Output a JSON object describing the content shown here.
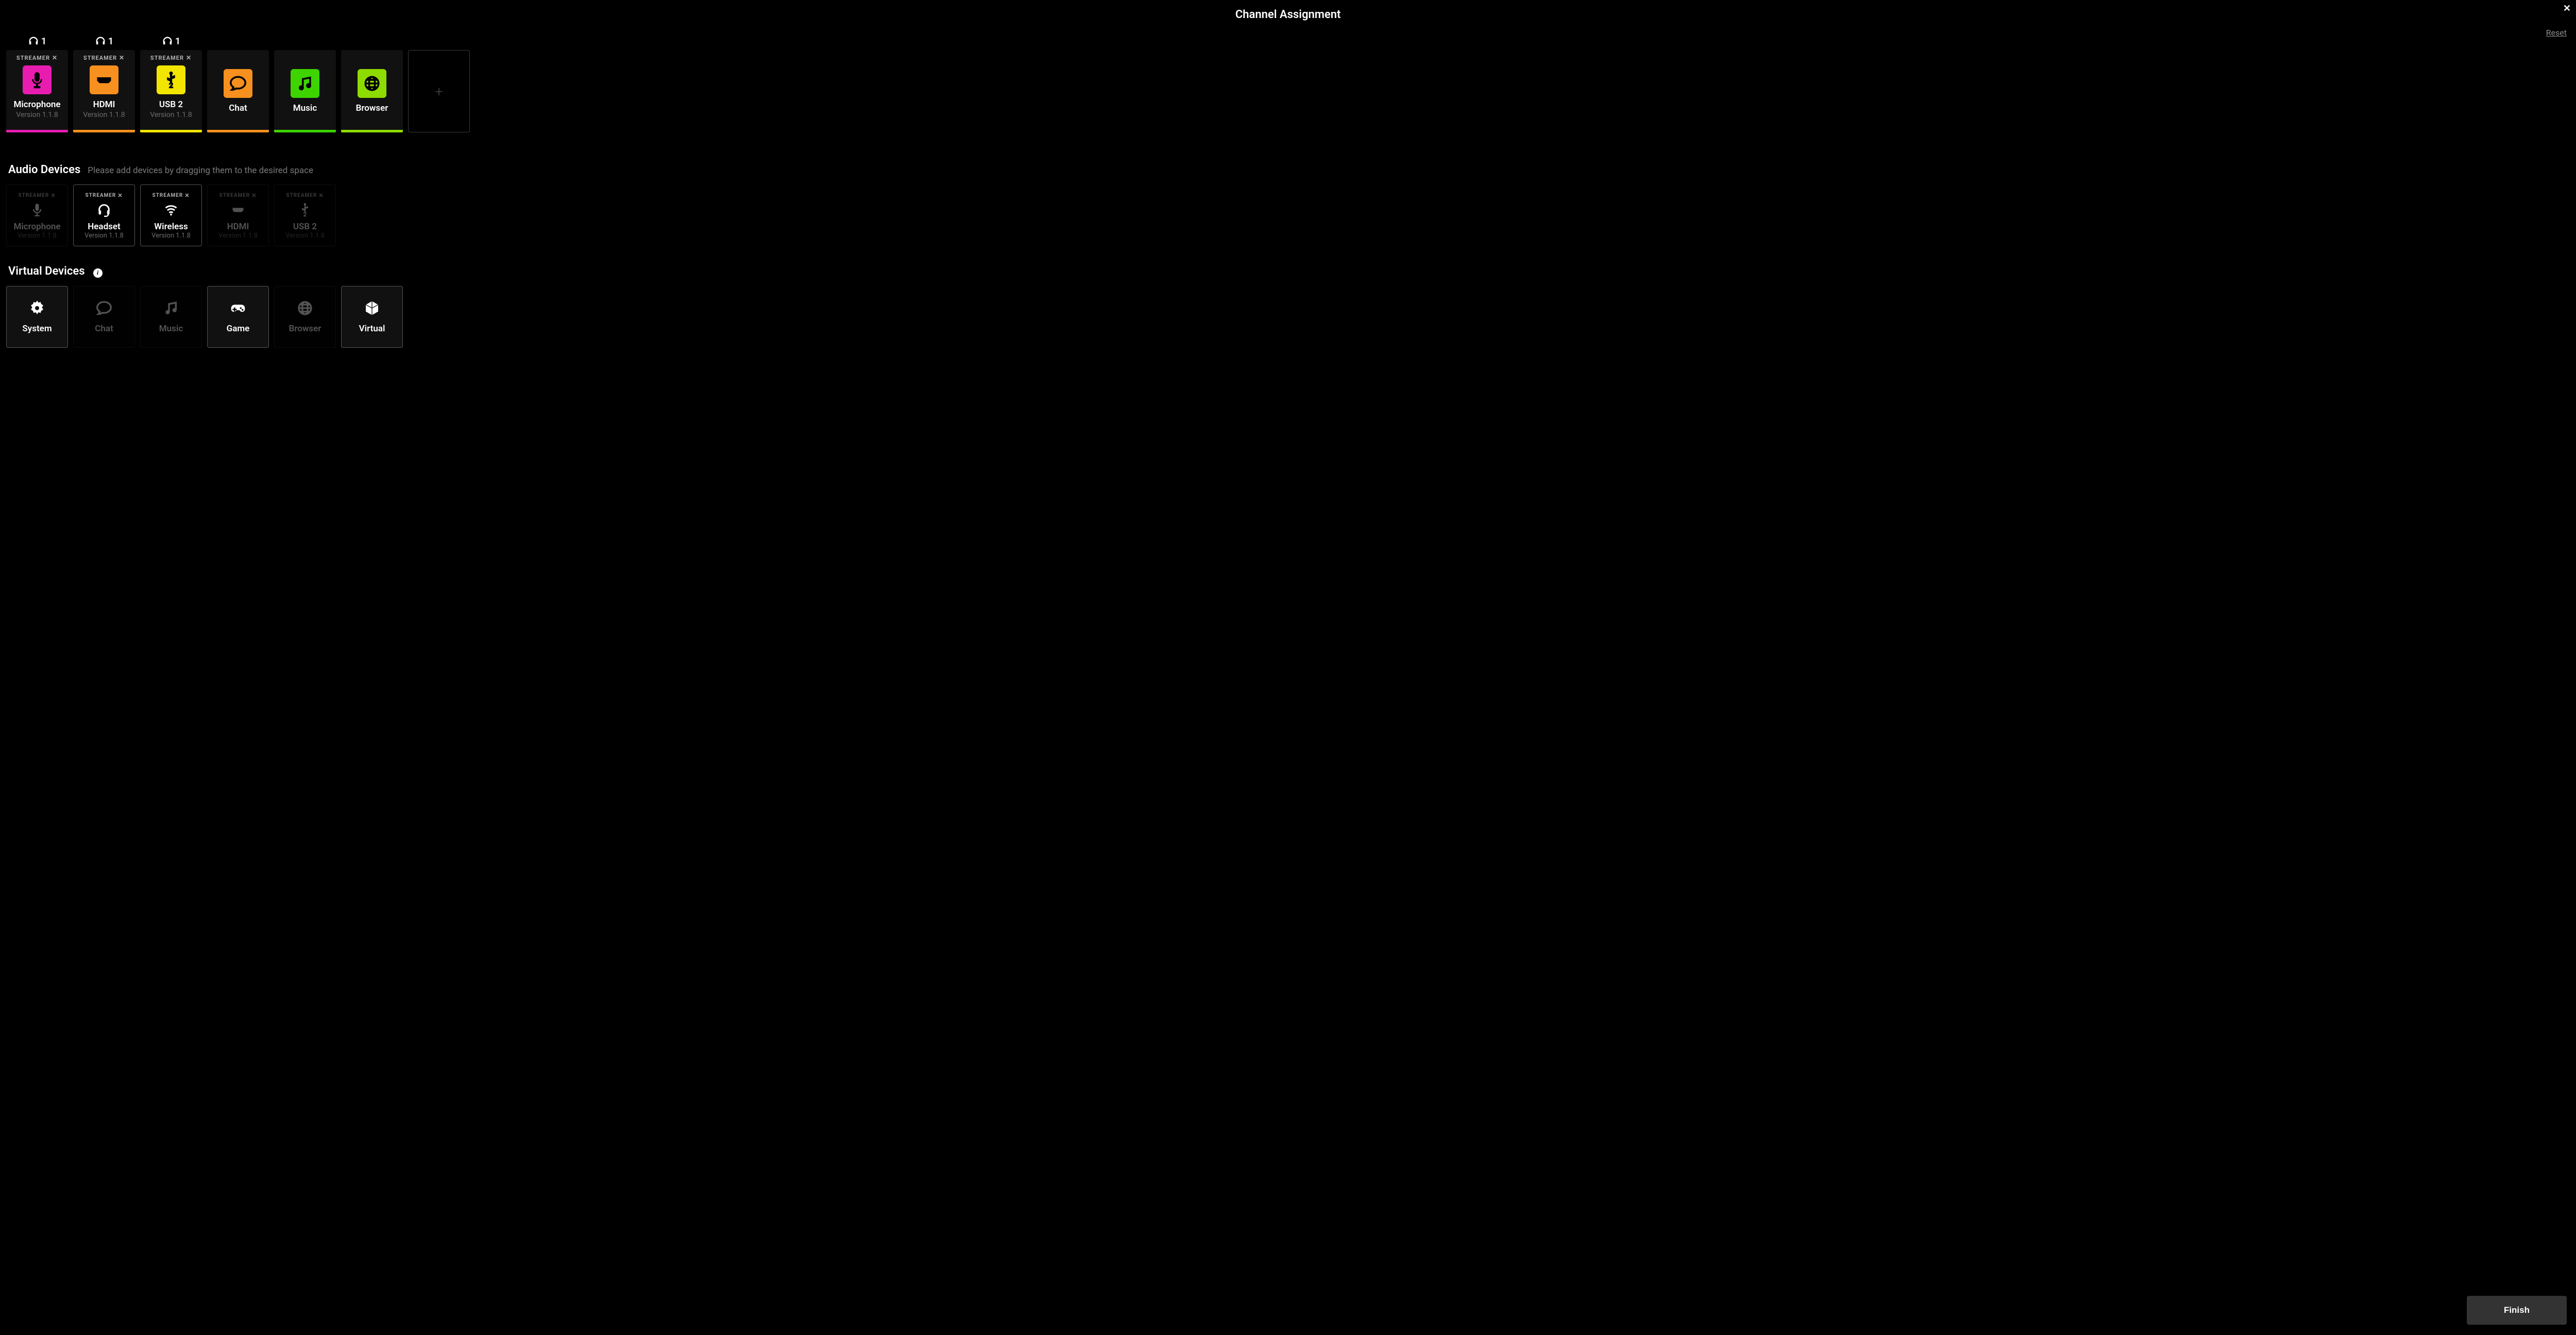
{
  "title": "Channel Assignment",
  "reset_label": "Reset",
  "finish_label": "Finish",
  "hp_marker": {
    "prefix": "",
    "num": "1"
  },
  "channels": [
    {
      "tag": "STREAMER X",
      "name": "Microphone",
      "version": "Version 1.1.8",
      "color": "#e81db0",
      "icon": "microphone",
      "hp": true
    },
    {
      "tag": "STREAMER X",
      "name": "HDMI",
      "version": "Version 1.1.8",
      "color": "#f7901e",
      "icon": "hdmi",
      "hp": true
    },
    {
      "tag": "STREAMER X",
      "name": "USB 2",
      "version": "Version 1.1.8",
      "color": "#f2e500",
      "icon": "usb2",
      "hp": true
    },
    {
      "name": "Chat",
      "color": "#f7901e",
      "icon": "chat",
      "simple": true
    },
    {
      "name": "Music",
      "color": "#3dd400",
      "icon": "music",
      "simple": true
    },
    {
      "name": "Browser",
      "color": "#8edb00",
      "icon": "globe",
      "simple": true
    }
  ],
  "audio_devices": {
    "heading": "Audio Devices",
    "hint": "Please add devices by dragging them to the desired space",
    "items": [
      {
        "tag": "STREAMER X",
        "name": "Microphone",
        "version": "Version 1.1.8",
        "icon": "microphone",
        "used": true
      },
      {
        "tag": "STREAMER X",
        "name": "Headset",
        "version": "Version 1.1.8",
        "icon": "headset",
        "used": false
      },
      {
        "tag": "STREAMER X",
        "name": "Wireless",
        "version": "Version 1.1.8",
        "icon": "wifi",
        "used": false
      },
      {
        "tag": "STREAMER X",
        "name": "HDMI",
        "version": "Version 1.1.8",
        "icon": "hdmi",
        "used": true
      },
      {
        "tag": "STREAMER X",
        "name": "USB 2",
        "version": "Version 1.1.8",
        "icon": "usb2",
        "used": true
      }
    ]
  },
  "virtual_devices": {
    "heading": "Virtual Devices",
    "items": [
      {
        "name": "System",
        "icon": "gear",
        "used": false
      },
      {
        "name": "Chat",
        "icon": "chat",
        "used": true
      },
      {
        "name": "Music",
        "icon": "music",
        "used": true
      },
      {
        "name": "Game",
        "icon": "game",
        "used": false
      },
      {
        "name": "Browser",
        "icon": "globe",
        "used": true
      },
      {
        "name": "Virtual",
        "icon": "cube",
        "used": false
      }
    ]
  }
}
